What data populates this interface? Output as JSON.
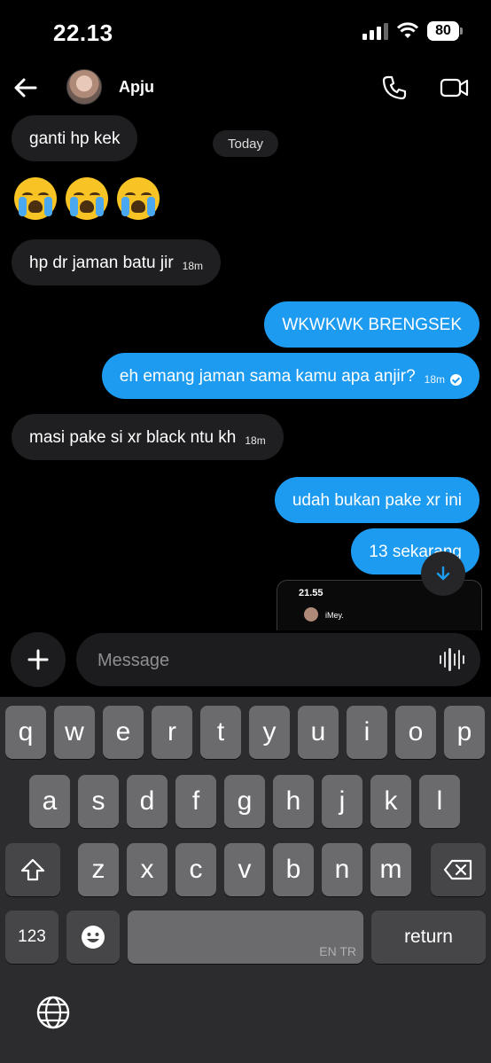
{
  "status_bar": {
    "time": "22.13",
    "battery": "80"
  },
  "header": {
    "contact_name": "Apju"
  },
  "chat": {
    "date_chip": "Today",
    "messages": [
      {
        "text": "ganti hp kek",
        "time": ""
      },
      {
        "text": "😭😭😭",
        "time": ""
      },
      {
        "text": "hp dr jaman batu jir",
        "time": "18m"
      },
      {
        "text": "WKWKWK BRENGSEK",
        "time": ""
      },
      {
        "text": "eh emang jaman sama kamu apa anjir?",
        "time": "18m"
      },
      {
        "text": "masi pake si xr black ntu kh",
        "time": "18m"
      },
      {
        "text": "udah bukan pake xr ini",
        "time": ""
      },
      {
        "text": "13 sekarang",
        "time": ""
      }
    ],
    "preview": {
      "time": "21.55",
      "name": "iMey."
    }
  },
  "composer": {
    "placeholder": "Message"
  },
  "keyboard": {
    "row1": [
      "q",
      "w",
      "e",
      "r",
      "t",
      "y",
      "u",
      "i",
      "o",
      "p"
    ],
    "row2": [
      "a",
      "s",
      "d",
      "f",
      "g",
      "h",
      "j",
      "k",
      "l"
    ],
    "row3": [
      "z",
      "x",
      "c",
      "v",
      "b",
      "n",
      "m"
    ],
    "numbers_key": "123",
    "space_label": "EN TR",
    "return_key": "return"
  },
  "colors": {
    "outgoing_bubble": "#1d9bf0",
    "incoming_bubble": "#1f1f21",
    "background": "#000000"
  }
}
